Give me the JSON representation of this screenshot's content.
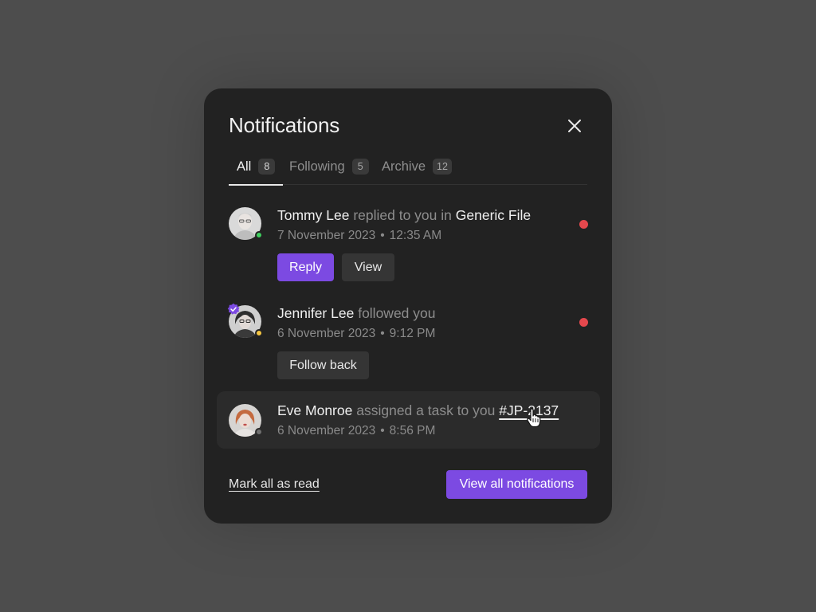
{
  "panel": {
    "title": "Notifications",
    "close_icon": "close-icon"
  },
  "tabs": [
    {
      "label": "All",
      "count": "8",
      "active": true
    },
    {
      "label": "Following",
      "count": "5",
      "active": false
    },
    {
      "label": "Archive",
      "count": "12",
      "active": false
    }
  ],
  "notifications": [
    {
      "actor": "Tommy Lee",
      "action": "replied to you in",
      "target": "Generic File",
      "date": "7 November 2023",
      "time": "12:35 AM",
      "status_color": "#3fcf5e",
      "unread": true,
      "buttons": {
        "primary": "Reply",
        "secondary": "View"
      }
    },
    {
      "actor": "Jennifer Lee",
      "action": "followed you",
      "date": "6 November 2023",
      "time": "9:12 PM",
      "status_color": "#f5c542",
      "verified": true,
      "unread": true,
      "buttons": {
        "secondary": "Follow back"
      }
    },
    {
      "actor": "Eve Monroe",
      "action": "assigned a task to you",
      "target": "#JP-2137",
      "date": "6 November 2023",
      "time": "8:56 PM",
      "status_color": "#6f6f6f",
      "unread": false
    }
  ],
  "footer": {
    "mark_all_label": "Mark all as read",
    "view_all_label": "View all notifications"
  },
  "colors": {
    "accent": "#7c4ae2",
    "unread_dot": "#e5484d",
    "panel_bg": "#222222",
    "page_bg": "#4d4d4d"
  }
}
